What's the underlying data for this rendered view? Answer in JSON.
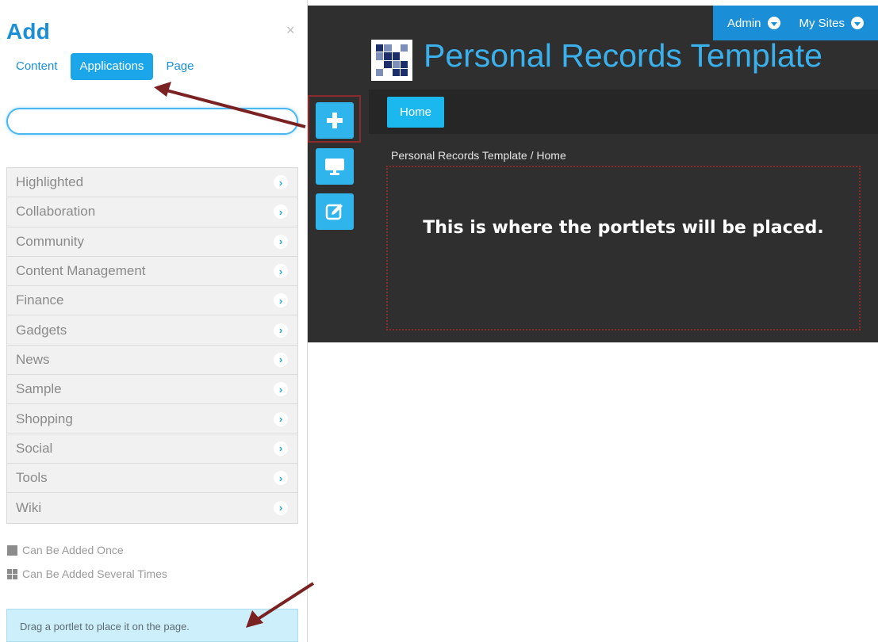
{
  "panel": {
    "title": "Add",
    "close_symbol": "×",
    "tabs": [
      {
        "label": "Content",
        "active": false
      },
      {
        "label": "Applications",
        "active": true
      },
      {
        "label": "Page",
        "active": false
      }
    ],
    "search": {
      "value": "",
      "placeholder": ""
    },
    "categories": [
      {
        "label": "Highlighted"
      },
      {
        "label": "Collaboration"
      },
      {
        "label": "Community"
      },
      {
        "label": "Content Management"
      },
      {
        "label": "Finance"
      },
      {
        "label": "Gadgets"
      },
      {
        "label": "News"
      },
      {
        "label": "Sample"
      },
      {
        "label": "Shopping"
      },
      {
        "label": "Social"
      },
      {
        "label": "Tools"
      },
      {
        "label": "Wiki"
      }
    ],
    "legend": {
      "once": "Can Be Added Once",
      "several": "Can Be Added Several Times"
    },
    "drag_note": "Drag a portlet to place it on the page."
  },
  "topbar": {
    "admin_label": "Admin",
    "my_sites_label": "My Sites"
  },
  "site": {
    "title": "Personal Records Template",
    "nav_home": "Home",
    "breadcrumb": "Personal Records Template / Home",
    "portlet_message": "This is where the portlets will be placed."
  },
  "dockbar": {
    "icons": [
      "plus-icon",
      "monitor-icon",
      "edit-icon"
    ]
  },
  "colors": {
    "accent": "#1a8fd8",
    "button": "#2fb4ec",
    "dark_bg": "#2f2f2f",
    "annotation": "#8b2a2a"
  }
}
